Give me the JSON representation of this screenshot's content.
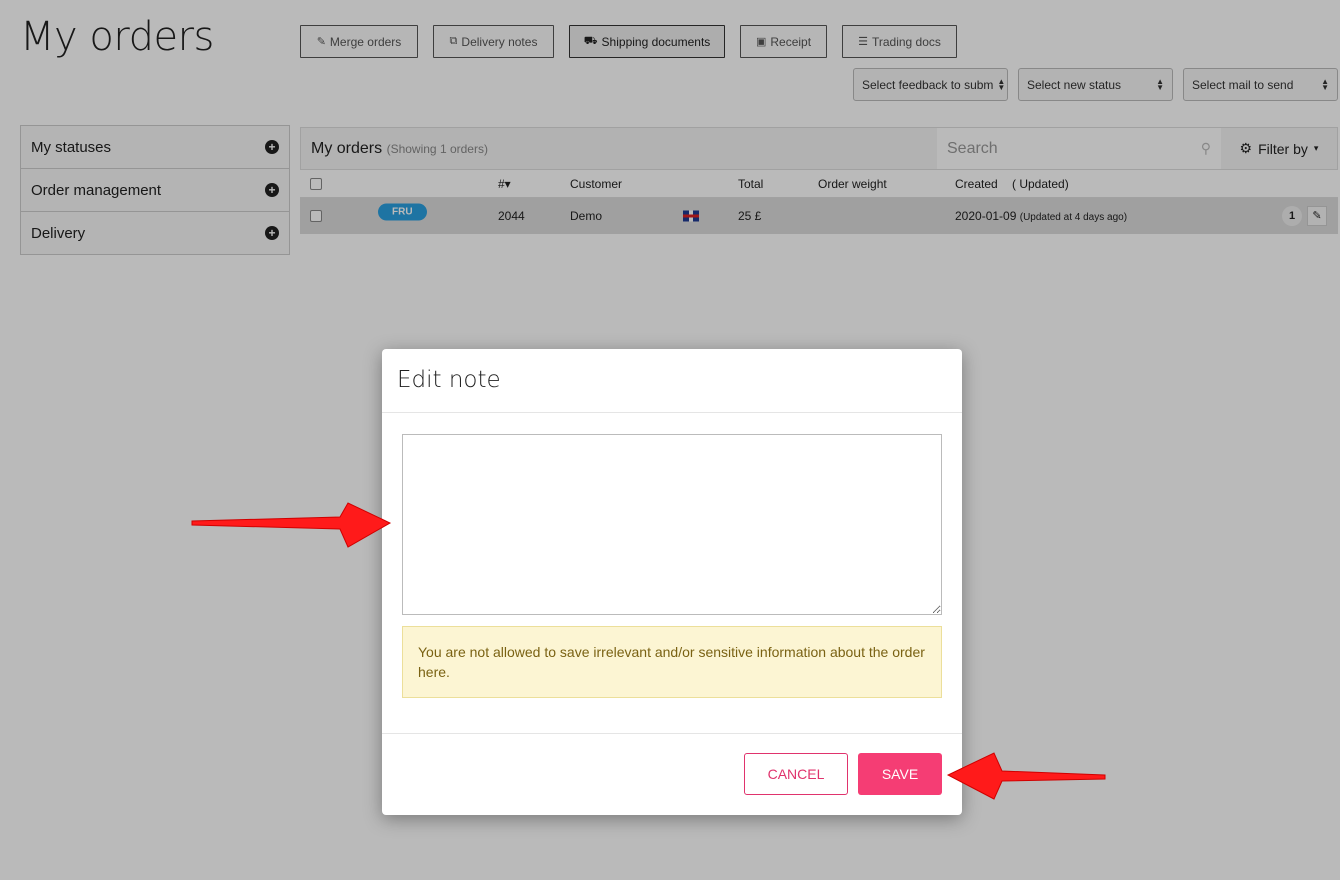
{
  "page": {
    "title": "My orders"
  },
  "toolbar": {
    "buttons": [
      {
        "label": "Merge orders",
        "icon": "edit-icon"
      },
      {
        "label": "Delivery notes",
        "icon": "copy-icon"
      },
      {
        "label": "Shipping documents",
        "icon": "truck-icon"
      },
      {
        "label": "Receipt",
        "icon": "money-icon"
      },
      {
        "label": "Trading docs",
        "icon": "list-icon"
      }
    ],
    "selects": [
      {
        "value": "Select feedback to subm"
      },
      {
        "value": "Select new status"
      },
      {
        "value": "Select mail to send"
      }
    ]
  },
  "sidebar": {
    "items": [
      {
        "label": "My statuses"
      },
      {
        "label": "Order management"
      },
      {
        "label": "Delivery"
      }
    ]
  },
  "orders": {
    "title": "My orders",
    "subtitle": "(Showing 1 orders)",
    "search_placeholder": "Search",
    "filter_label": "Filter by",
    "columns": {
      "number": "#▾",
      "customer": "Customer",
      "total": "Total",
      "weight": "Order weight",
      "created": "Created",
      "updated": "( Updated)"
    },
    "rows": [
      {
        "badge": "FRU",
        "number": "2044",
        "customer": "Demo",
        "total": "25 £",
        "created": "2020-01-09",
        "updated": "(Updated at 4 days ago)",
        "count": "1",
        "flag": "uk-flag-icon"
      }
    ]
  },
  "modal": {
    "title": "Edit note",
    "note_value": "",
    "warning": "You are not allowed to save irrelevant and/or sensitive information about the order here.",
    "cancel_label": "CANCEL",
    "save_label": "SAVE"
  },
  "colors": {
    "accent": "#f53d74",
    "badge": "#2a9fe0",
    "alert_bg": "#fcf5d3",
    "arrow": "#ff0000"
  }
}
